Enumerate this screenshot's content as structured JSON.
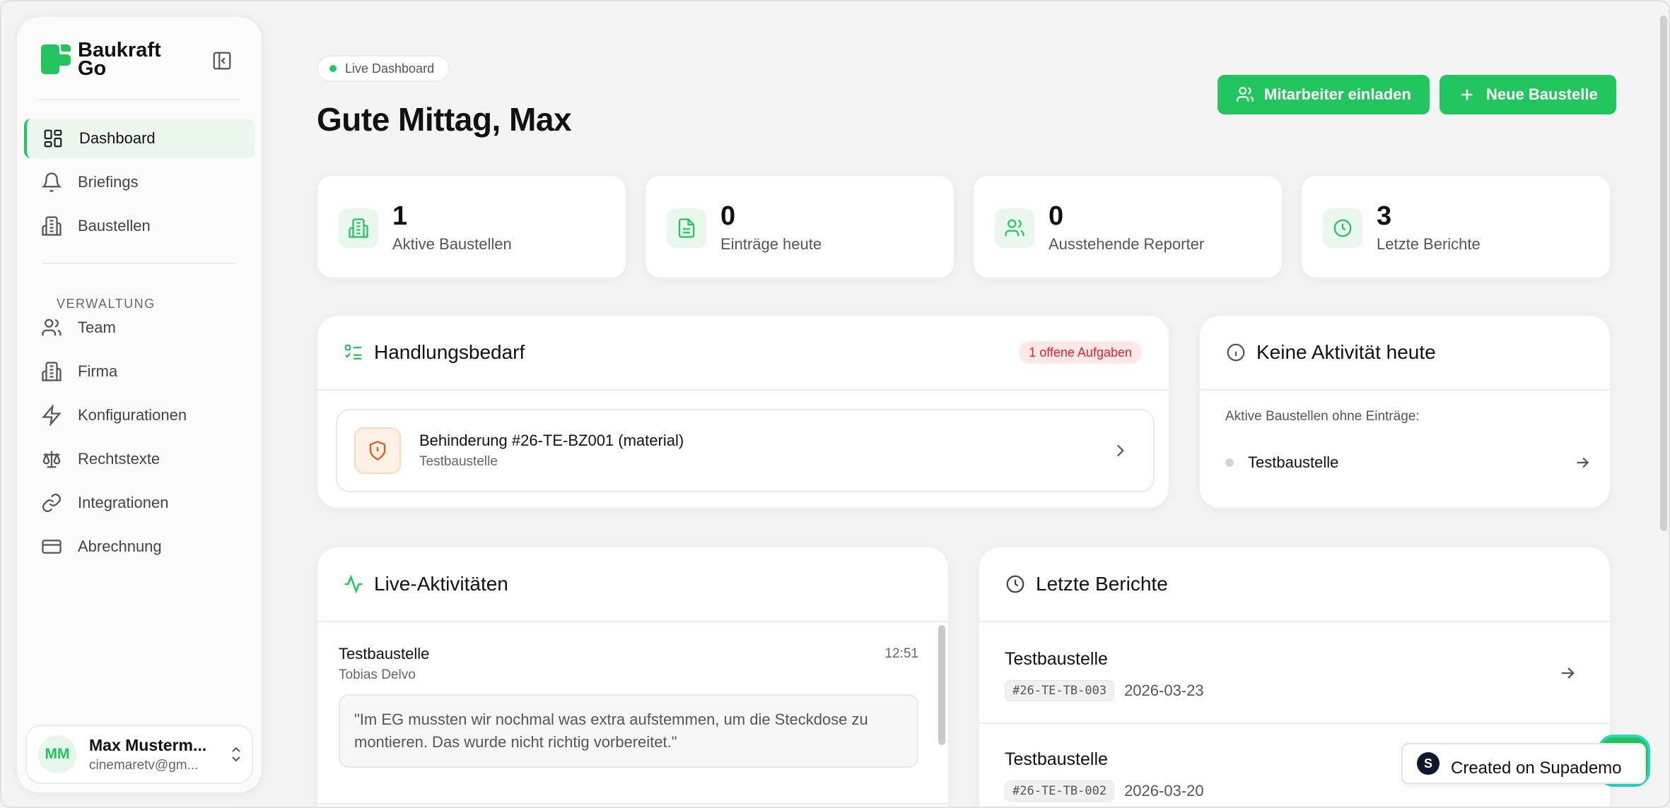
{
  "brand": {
    "name_line1": "Baukraft",
    "name_line2": "Go",
    "accent": "#22c55e"
  },
  "sidebar": {
    "items": [
      {
        "label": "Dashboard",
        "icon": "dashboard-icon",
        "active": true
      },
      {
        "label": "Briefings",
        "icon": "bell-icon"
      },
      {
        "label": "Baustellen",
        "icon": "building-icon"
      }
    ],
    "section_label": "VERWALTUNG",
    "admin_items": [
      {
        "label": "Team",
        "icon": "users-icon"
      },
      {
        "label": "Firma",
        "icon": "building-icon"
      },
      {
        "label": "Konfigurationen",
        "icon": "bolt-icon"
      },
      {
        "label": "Rechtstexte",
        "icon": "scale-icon"
      },
      {
        "label": "Integrationen",
        "icon": "link-icon"
      },
      {
        "label": "Abrechnung",
        "icon": "credit-card-icon"
      }
    ],
    "user": {
      "initials": "MM",
      "name": "Max Musterm...",
      "email": "cinemaretv@gm..."
    }
  },
  "header": {
    "pill": "Live Dashboard",
    "greeting": "Gute Mittag, Max",
    "invite_label": "Mitarbeiter einladen",
    "new_site_label": "Neue Baustelle"
  },
  "stats": [
    {
      "value": "1",
      "label": "Aktive Baustellen",
      "icon": "building-icon"
    },
    {
      "value": "0",
      "label": "Einträge heute",
      "icon": "document-icon"
    },
    {
      "value": "0",
      "label": "Ausstehende Reporter",
      "icon": "users-icon"
    },
    {
      "value": "3",
      "label": "Letzte Berichte",
      "icon": "clock-icon"
    }
  ],
  "action": {
    "title": "Handlungsbedarf",
    "badge": "1 offene Aufgaben",
    "task_title": "Behinderung #26-TE-BZ001 (material)",
    "task_sub": "Testbaustelle"
  },
  "no_activity": {
    "title": "Keine Aktivität heute",
    "label": "Aktive Baustellen ohne Einträge:",
    "site": "Testbaustelle"
  },
  "live": {
    "title": "Live-Aktivitäten",
    "item": {
      "site": "Testbaustelle",
      "user": "Tobias Delvo",
      "time": "12:51",
      "quote": "\"Im EG mussten wir nochmal was extra aufstemmen, um die Steckdose zu montieren. Das wurde nicht richtig vorbereitet.\""
    }
  },
  "reports": {
    "title": "Letzte Berichte",
    "items": [
      {
        "site": "Testbaustelle",
        "code": "#26-TE-TB-003",
        "date": "2026-03-23"
      },
      {
        "site": "Testbaustelle",
        "code": "#26-TE-TB-002",
        "date": "2026-03-20"
      }
    ]
  },
  "supademo": {
    "logo": "S",
    "label": "Created on Supademo"
  }
}
